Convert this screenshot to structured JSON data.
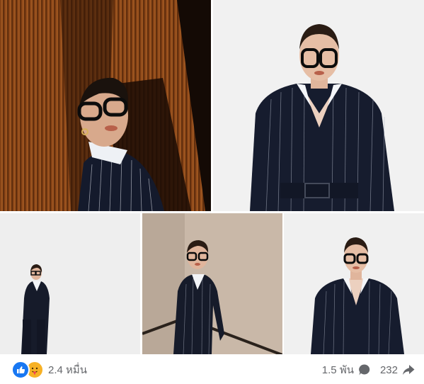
{
  "photos": [
    {
      "description": "woman in glasses and pinstripe suit against wood panel"
    },
    {
      "description": "woman in pinstripe suit, white backdrop"
    },
    {
      "description": "full-length pose leaning on wall"
    },
    {
      "description": "pose on staircase with handrail"
    },
    {
      "description": "close-up in pinstripe suit"
    }
  ],
  "footer": {
    "reaction_icons": [
      "like-icon",
      "care-icon"
    ],
    "reaction_count": "2.4 หมื่น",
    "comment_count": "1.5 พัน",
    "share_count": "232"
  },
  "colors": {
    "like": "#1877f2",
    "care": "#f7b125",
    "meta_text": "#65676b"
  }
}
